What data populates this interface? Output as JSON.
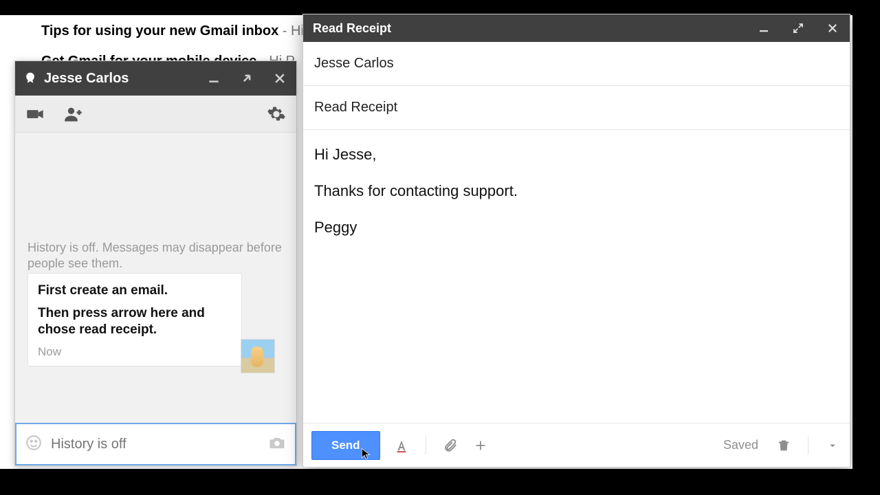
{
  "inbox": {
    "rows": [
      {
        "subject": "Tips for using your new Gmail inbox",
        "preview": " - Hi P"
      },
      {
        "subject": "Get Gmail for your mobile device",
        "preview": " - Hi P"
      }
    ]
  },
  "chat": {
    "title": "Jesse Carlos",
    "history_note": "History is off. Messages may disappear before people see them.",
    "message_line1": "First create an email.",
    "message_line2": "Then press arrow here and chose read receipt.",
    "timestamp": "Now",
    "input_placeholder": "History is off"
  },
  "compose": {
    "title": "Read Receipt",
    "to": "Jesse Carlos",
    "subject": "Read Receipt",
    "body_line1": "Hi Jesse,",
    "body_line2": "Thanks for contacting support.",
    "body_line3": "Peggy",
    "send_label": "Send",
    "saved_label": "Saved"
  }
}
